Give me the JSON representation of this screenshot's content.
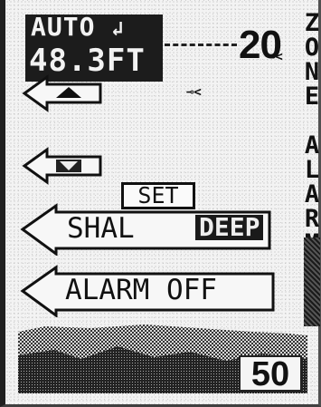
{
  "header": {
    "mode": "AUTO",
    "depth": "48.3FT"
  },
  "range": {
    "top": "20",
    "bottom": "50"
  },
  "sonar": {
    "fish_symbol": "⊸<"
  },
  "side_label": {
    "letters": [
      "Z",
      "O",
      "N",
      "E",
      "",
      "A",
      "L",
      "A",
      "R",
      "M"
    ]
  },
  "menu": {
    "set_label": "SET",
    "shallow_label": "SHAL",
    "deep_label": "DEEP",
    "alarm_label": "ALARM OFF"
  },
  "icons": {
    "up": "up-arrow-icon",
    "down": "down-arrow-icon",
    "fish": "fish-icon",
    "pointer": "left-pointer-icon"
  },
  "colors": {
    "screen": "#f3f3f3",
    "ink": "#111111",
    "inverse_bg": "#1c1c1c"
  }
}
